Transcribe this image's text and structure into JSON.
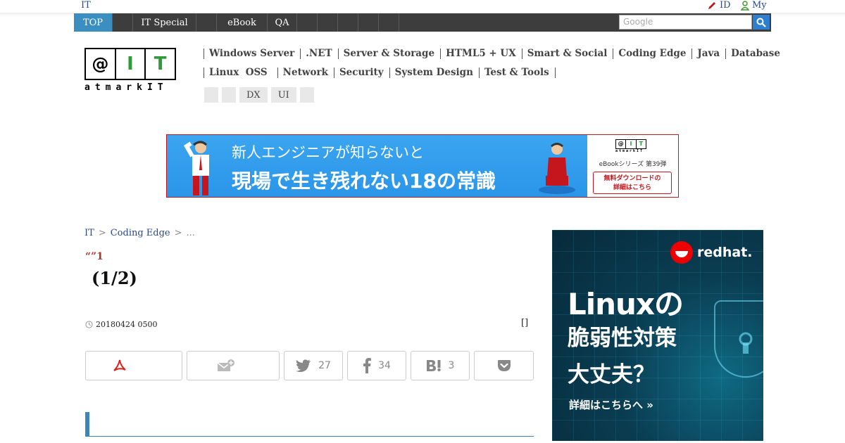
{
  "utility": {
    "home": "IT",
    "id_label": "ID",
    "my_label": "My"
  },
  "globalnav": {
    "items": [
      "TOP",
      "",
      "IT Special",
      "",
      "eBook",
      "QA",
      "",
      "",
      "",
      "",
      ""
    ],
    "search_placeholder": "Google"
  },
  "logo": {
    "boxes": [
      "@",
      "I",
      "T"
    ],
    "wordmark": "atmarkIT"
  },
  "categories": {
    "row1": [
      "Windows Server",
      ".NET",
      "Server & Storage",
      "HTML5 + UX",
      "Smart & Social",
      "Coding Edge",
      "Java",
      "Database"
    ],
    "row2": [
      "Linux  OSS",
      "Network",
      "Security",
      "System Design",
      "Test & Tools"
    ],
    "chips": [
      "",
      "",
      "DX",
      "UI",
      ""
    ]
  },
  "banner": {
    "line1": "新人エンジニアが知らないと",
    "line2": "現場で生き残れない18の常識",
    "logo_boxes": [
      "@",
      "I",
      "T"
    ],
    "logo_wordmark": "atmarkIT",
    "series": "eBookシリーズ 第39弾",
    "cta_line1": "無料ダウンロードの",
    "cta_line2": "詳細はこちら"
  },
  "breadcrumb": {
    "items": [
      "IT",
      "Coding Edge"
    ],
    "tail": "..."
  },
  "article": {
    "kicker": "“”1",
    "title": "(1/2)",
    "date": "20180424 0500",
    "bracket": "[]"
  },
  "share": {
    "twitter_count": "27",
    "facebook_count": "34",
    "hatena_count": "3"
  },
  "sidead": {
    "brand": "redhat.",
    "headline1": "Linuxの",
    "headline2": "脆弱性対策",
    "headline3": "大丈夫？",
    "more": "詳細はこちらへ »"
  },
  "colors": {
    "nav_bg": "#3d3d3d",
    "nav_active": "#3a8fc0",
    "link": "#2a4a8a",
    "kicker": "#b2332a",
    "section_accent": "#3f86b7",
    "banner_blue": "#2b95e8",
    "redhat": "#ee0000"
  }
}
